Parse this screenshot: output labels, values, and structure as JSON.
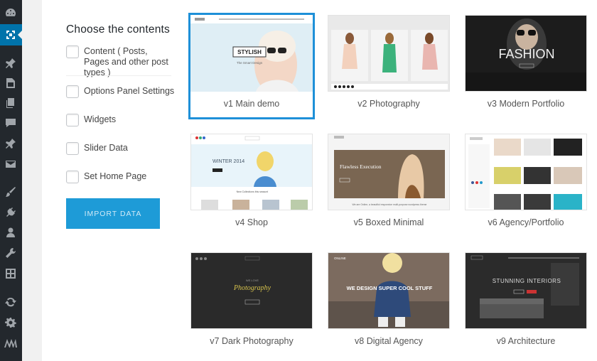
{
  "sidebar": {
    "icons": [
      "dashboard-icon",
      "import-icon",
      "pin-icon",
      "media-icon",
      "pages-icon",
      "comments-icon",
      "pin-icon-2",
      "mail-icon",
      "brush-icon",
      "plugin-icon",
      "users-icon",
      "wrench-icon",
      "grid-icon",
      "refresh-icon",
      "gear-icon",
      "logo-icon"
    ]
  },
  "panel": {
    "title": "Choose the contents",
    "options": [
      {
        "label": "Content ( Posts, Pages and other post types )"
      },
      {
        "label": "Options Panel Settings"
      },
      {
        "label": "Widgets"
      },
      {
        "label": "Slider Data"
      },
      {
        "label": "Set Home Page"
      }
    ],
    "import_label": "IMPORT DATA"
  },
  "demos": [
    {
      "caption": "v1 Main demo",
      "selected": true,
      "banner": "STYLISH",
      "sub": "The Smart Design"
    },
    {
      "caption": "v2 Photography"
    },
    {
      "caption": "v3 Modern Portfolio",
      "banner": "FASHION"
    },
    {
      "caption": "v4 Shop",
      "banner": "WINTER 2014",
      "sub": "New Collections this season!"
    },
    {
      "caption": "v5 Boxed Minimal",
      "banner": "Flawless Execution",
      "sub": "We are Online, a beautiful responsive multi-purpose wordpress theme"
    },
    {
      "caption": "v6 Agency/Portfolio"
    },
    {
      "caption": "v7 Dark Photography",
      "banner": "Photography",
      "sub": "WE LOVE"
    },
    {
      "caption": "v8 Digital Agency",
      "banner": "WE DESIGN SUPER COOL STUFF",
      "sub": "ONLINE"
    },
    {
      "caption": "v9 Architecture",
      "banner": "STUNNING INTERIORS"
    }
  ]
}
